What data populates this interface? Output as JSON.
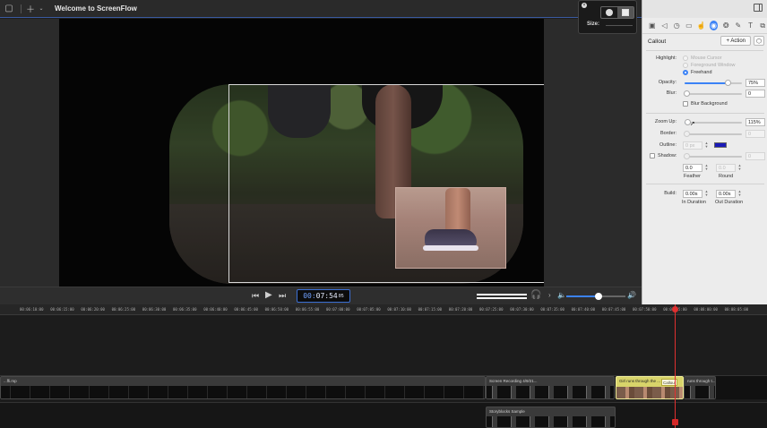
{
  "titlebar": {
    "title": "Welcome to ScreenFlow"
  },
  "size_popover": {
    "label": "Size:"
  },
  "panel": {
    "title": "Callout",
    "action_label": "+ Action",
    "highlight_label": "Highlight:",
    "highlight_options": [
      "Mouse Cursor",
      "Foreground Window",
      "Freehand"
    ],
    "opacity_label": "Opacity:",
    "opacity_value": "75%",
    "opacity_fraction": 0.75,
    "blur_label": "Blur:",
    "blur_value": "0",
    "blur_background_label": "Blur Background",
    "zoom_label": "Zoom Up:",
    "zoom_value": "115%",
    "border_label": "Border:",
    "border_value": "0",
    "outline_label": "Outline:",
    "outline_value": "0 px",
    "outline_color": "#1a1ab8",
    "shadow_label": "Shadow:",
    "shadow_value": "0",
    "feather_value": "0.0",
    "feather_label": "Feather",
    "round_value": "0.0",
    "round_label": "Round",
    "build_label": "Build:",
    "in_duration_value": "0.00s",
    "in_duration_label": "In Duration",
    "out_duration_value": "0.00s",
    "out_duration_label": "Out Duration"
  },
  "transport": {
    "timecode_prefix": "00:",
    "timecode_main": "07:54",
    "timecode_frames": "05"
  },
  "timeline": {
    "ruler_ticks": [
      "00:06:10:00",
      "00:06:15:00",
      "00:06:20:00",
      "00:06:25:00",
      "00:06:30:00",
      "00:06:35:00",
      "00:06:40:00",
      "00:06:45:00",
      "00:06:50:00",
      "00:06:55:00",
      "00:07:00:00",
      "00:07:05:00",
      "00:07:10:00",
      "00:07:15:00",
      "00:07:20:00",
      "00:07:25:00",
      "00:07:30:00",
      "00:07:35:00",
      "00:07:40:00",
      "00:07:45:00",
      "00:07:50:00",
      "00:07:55:00",
      "00:08:00:00",
      "00:08:05:00"
    ],
    "clips": {
      "left_clip": "...ffi.mp",
      "screen_recording": "Screen Recording 4/9/21...",
      "girl_clip": "Girl runs through the ...",
      "girl_clip_right": "runs through t...",
      "callout_tag": "Callout",
      "storyblocks": "Storyblocks Sample"
    }
  }
}
